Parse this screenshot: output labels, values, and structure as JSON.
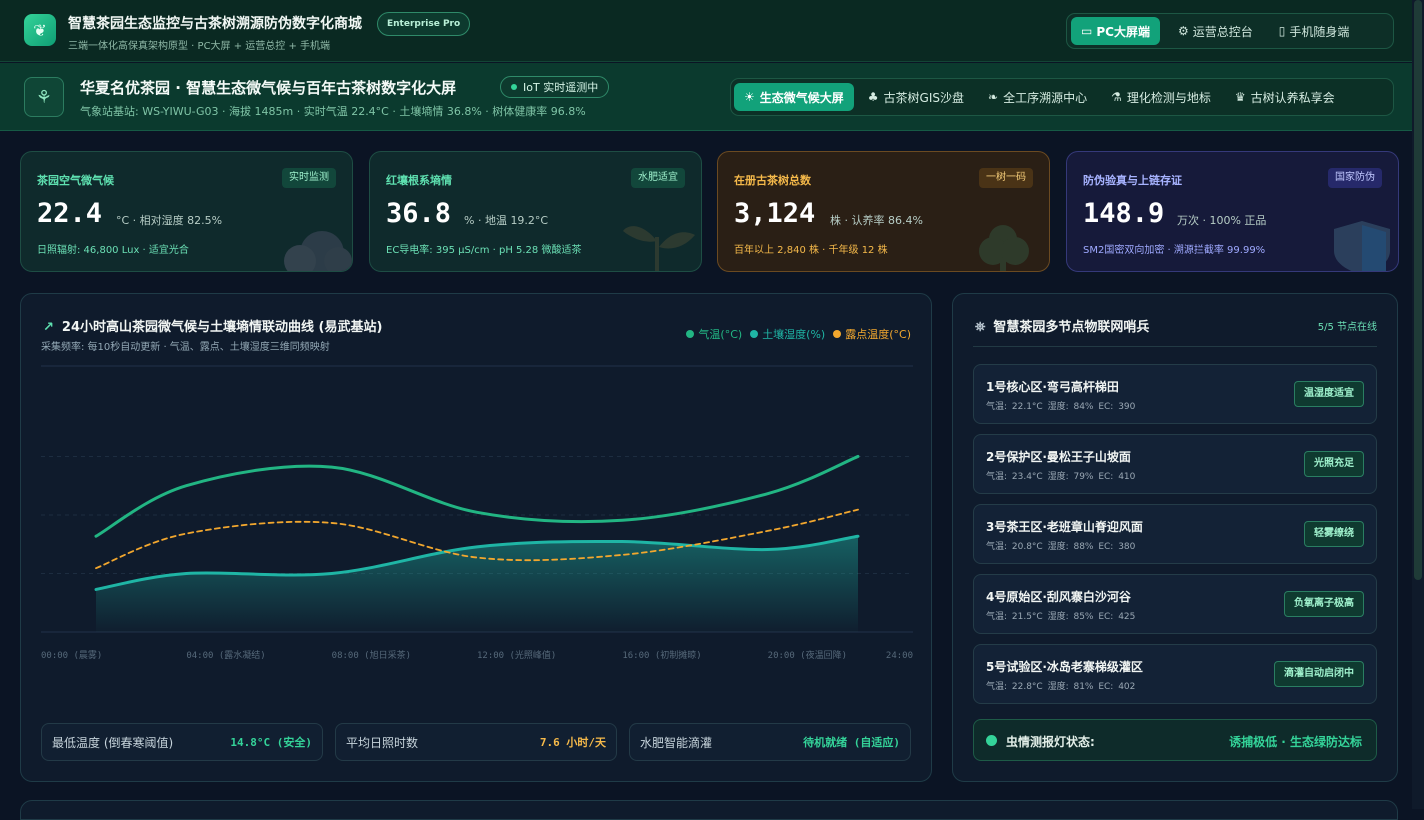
{
  "app": {
    "title": "智慧茶园生态监控与古茶树溯源防伪数字化商城",
    "subtitle": "三端一体化高保真架构原型 · PC大屏 + 运营总控 + 手机端",
    "badge": "Enterprise Pro",
    "modes": [
      {
        "label": "PC大屏端",
        "icon": "monitor-icon",
        "active": true
      },
      {
        "label": "运营总控台",
        "icon": "gear-icon",
        "active": false
      },
      {
        "label": "手机随身端",
        "icon": "phone-icon",
        "active": false
      }
    ]
  },
  "banner": {
    "title": "华夏名优茶园 · 智慧生态微气候与百年古茶树数字化大屏",
    "iot_status": "IoT 实时遥测中",
    "station_info": "气象站基站: WS-YIWU-G03 · 海拔 1485m · 实时气温 22.4°C · 土壤墒情 36.8% · 树体健康率 96.8%",
    "tabs": [
      {
        "label": "生态微气候大屏",
        "icon": "sun-cloud-icon",
        "active": true
      },
      {
        "label": "古茶树GIS沙盘",
        "icon": "tree-icon",
        "active": false
      },
      {
        "label": "全工序溯源中心",
        "icon": "leaf-icon",
        "active": false
      },
      {
        "label": "理化检测与地标",
        "icon": "microscope-icon",
        "active": false
      },
      {
        "label": "古树认养私享会",
        "icon": "trophy-icon",
        "active": false
      }
    ]
  },
  "kpis": [
    {
      "label": "茶园空气微气候",
      "tag": "实时监测",
      "value": "22.4",
      "unit": "°C · 相对湿度 82.5%",
      "foot": "日照辐射: 46,800 Lux · 适宜光合"
    },
    {
      "label": "红壤根系墒情",
      "tag": "水肥适宜",
      "value": "36.8",
      "unit": "% · 地温 19.2°C",
      "foot": "EC导电率: 395 μS/cm · pH 5.28 微酸适茶"
    },
    {
      "label": "在册古茶树总数",
      "tag": "一树一码",
      "value": "3,124",
      "unit": "株 · 认养率 86.4%",
      "foot": "百年以上 2,840 株 · 千年级 12 株"
    },
    {
      "label": "防伪验真与上链存证",
      "tag": "国家防伪",
      "value": "148.9",
      "unit": "万次 · 100% 正品",
      "foot": "SM2国密双向加密 · 溯源拦截率 99.99%"
    }
  ],
  "chart": {
    "title": "24小时高山茶园微气候与土壤墒情联动曲线 (易武基站)",
    "subtitle": "采集频率: 每10秒自动更新 · 气温、露点、土壤湿度三维同频映射",
    "colors": {
      "temp": "#22b583",
      "soil": "#1fb5a5",
      "dew": "#f2a72e"
    },
    "stats": [
      {
        "label": "最低温度 (倒春寒阈值)",
        "value": "14.8°C (安全)",
        "color": "#34d399"
      },
      {
        "label": "平均日照时数",
        "value": "7.6 小时/天",
        "color": "#f5b94a"
      },
      {
        "label": "水肥智能滴灌",
        "value": "待机就绪 (自适应)",
        "color": "#34d399"
      }
    ]
  },
  "chart_data": {
    "type": "line",
    "title": "24小时高山茶园微气候与土壤墒情联动曲线 (易武基站)",
    "x": [
      0,
      4,
      8,
      12,
      16,
      20,
      24
    ],
    "tick_labels": [
      "00:00 (晨雾)",
      "04:00 (露水凝结)",
      "08:00 (旭日采茶)",
      "12:00 (光照峰值)",
      "16:00 (初制摊晾)",
      "20:00 (夜温回降)",
      "24:00"
    ],
    "series": [
      {
        "name": "气温(°C)",
        "key": "temp",
        "values": [
          0.36,
          0.55,
          0.62,
          0.45,
          0.42,
          0.52,
          0.66
        ]
      },
      {
        "name": "土壤湿度(%)",
        "key": "soil",
        "values": [
          0.16,
          0.22,
          0.22,
          0.32,
          0.34,
          0.31,
          0.36
        ],
        "area": true
      },
      {
        "name": "露点温度(°C)",
        "key": "dew",
        "values": [
          0.24,
          0.37,
          0.41,
          0.28,
          0.29,
          0.38,
          0.46
        ],
        "dashed": true
      }
    ],
    "grid": true,
    "legend": "top-right"
  },
  "sidebar": {
    "title": "智慧茶园多节点物联网哨兵",
    "count": "5/5 节点在线",
    "nodes": [
      {
        "name": "1号核心区·弯弓高杆梯田",
        "metrics": "气温: 22.1°C   湿度: 84%   EC: 390",
        "status": "温湿度适宜"
      },
      {
        "name": "2号保护区·曼松王子山坡面",
        "metrics": "气温: 23.4°C   湿度: 79%   EC: 410",
        "status": "光照充足"
      },
      {
        "name": "3号茶王区·老班章山脊迎风面",
        "metrics": "气温: 20.8°C   湿度: 88%   EC: 380",
        "status": "轻雾缭绕"
      },
      {
        "name": "4号原始区·刮风寨白沙河谷",
        "metrics": "气温: 21.5°C   湿度: 85%   EC: 425",
        "status": "负氧离子极高"
      },
      {
        "name": "5号试验区·冰岛老寨梯级灌区",
        "metrics": "气温: 22.8°C   湿度: 81%   EC: 402",
        "status": "滴灌自动启闭中"
      }
    ],
    "pest_label": "虫情测报灯状态:",
    "pest_value": "诱捕极低 · 生态绿防达标"
  }
}
